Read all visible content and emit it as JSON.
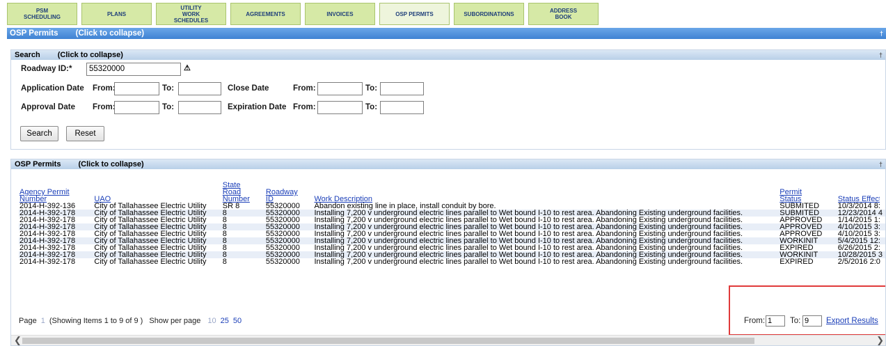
{
  "nav": {
    "tabs": [
      {
        "label": "PSM\nSCHEDULING"
      },
      {
        "label": "PLANS"
      },
      {
        "label": "UTILITY\nWORK\nSCHEDULES"
      },
      {
        "label": "AGREEMENTS"
      },
      {
        "label": "INVOICES"
      },
      {
        "label": "OSP PERMITS",
        "active": true
      },
      {
        "label": "SUBORDINATIONS"
      },
      {
        "label": "ADDRESS\nBOOK"
      }
    ]
  },
  "main_header": {
    "title": "OSP Permits",
    "collapse": "(Click to collapse)"
  },
  "search": {
    "header": {
      "title": "Search",
      "collapse": "(Click to collapse)"
    },
    "roadway_label": "Roadway ID:*",
    "roadway_value": "55320000",
    "application_date_label": "Application Date",
    "close_date_label": "Close Date",
    "approval_date_label": "Approval Date",
    "expiration_date_label": "Expiration Date",
    "from_label": "From:",
    "to_label": "To:",
    "search_button": "Search",
    "reset_button": "Reset"
  },
  "results": {
    "header": {
      "title": "OSP Permits",
      "collapse": "(Click to collapse)"
    },
    "columns": [
      "Agency Permit Number",
      "UAO",
      "State Road Number",
      "Roadway ID",
      "Work Description",
      "Permit Status",
      "Status Effect Date"
    ],
    "rows": [
      [
        "2014-H-392-136",
        "City of Tallahassee Electric Utility",
        "SR 8",
        "55320000",
        "Abandon existing line in place, install conduit by bore.",
        "SUBMITED",
        "10/3/2014 8:"
      ],
      [
        "2014-H-392-178",
        "City of Tallahassee Electric Utility",
        "8",
        "55320000",
        "Installing 7,200 v underground electric lines parallel to Wet bound I-10 to rest area. Abandoning Existing underground facilities.",
        "SUBMITED",
        "12/23/2014 4"
      ],
      [
        "2014-H-392-178",
        "City of Tallahassee Electric Utility",
        "8",
        "55320000",
        "Installing 7,200 v underground electric lines parallel to Wet bound I-10 to rest area. Abandoning Existing underground facilities.",
        "APPROVED",
        "1/14/2015 1:"
      ],
      [
        "2014-H-392-178",
        "City of Tallahassee Electric Utility",
        "8",
        "55320000",
        "Installing 7,200 v underground electric lines parallel to Wet bound I-10 to rest area. Abandoning Existing underground facilities.",
        "APPROVED",
        "4/10/2015 3:"
      ],
      [
        "2014-H-392-178",
        "City of Tallahassee Electric Utility",
        "8",
        "55320000",
        "Installing 7,200 v underground electric lines parallel to Wet bound I-10 to rest area. Abandoning Existing underground facilities.",
        "APPROVED",
        "4/10/2015 3:"
      ],
      [
        "2014-H-392-178",
        "City of Tallahassee Electric Utility",
        "8",
        "55320000",
        "Installing 7,200 v underground electric lines parallel to Wet bound I-10 to rest area. Abandoning Existing underground facilities.",
        "WORKINIT",
        "5/4/2015 12:"
      ],
      [
        "2014-H-392-178",
        "City of Tallahassee Electric Utility",
        "8",
        "55320000",
        "Installing 7,200 v underground electric lines parallel to Wet bound I-10 to rest area. Abandoning Existing underground facilities.",
        "EXPIRED",
        "6/26/2015 2:"
      ],
      [
        "2014-H-392-178",
        "City of Tallahassee Electric Utility",
        "8",
        "55320000",
        "Installing 7,200 v underground electric lines parallel to Wet bound I-10 to rest area. Abandoning Existing underground facilities.",
        "WORKINIT",
        "10/28/2015 3"
      ],
      [
        "2014-H-392-178",
        "City of Tallahassee Electric Utility",
        "8",
        "55320000",
        "Installing 7,200 v underground electric lines parallel to Wet bound I-10 to rest area. Abandoning Existing underground facilities.",
        "EXPIRED",
        "2/5/2016 2:0"
      ]
    ]
  },
  "pager": {
    "page_label": "Page",
    "current_page": "1",
    "showing": "(Showing Items 1 to 9 of 9 )",
    "per_page_label": "Show per page",
    "per_page_options": [
      "10",
      "25",
      "50"
    ]
  },
  "export": {
    "from_label": "From:",
    "from_value": "1",
    "to_label": "To:",
    "to_value": "9",
    "link": "Export Results"
  },
  "icons": {
    "warning": "warning-icon",
    "pin": "pin-icon"
  },
  "colors": {
    "nav_tab": "#d6e9a6",
    "header_bar": "#3f82d3",
    "link": "#1a3eb8",
    "highlight_box": "#e03a3a"
  }
}
